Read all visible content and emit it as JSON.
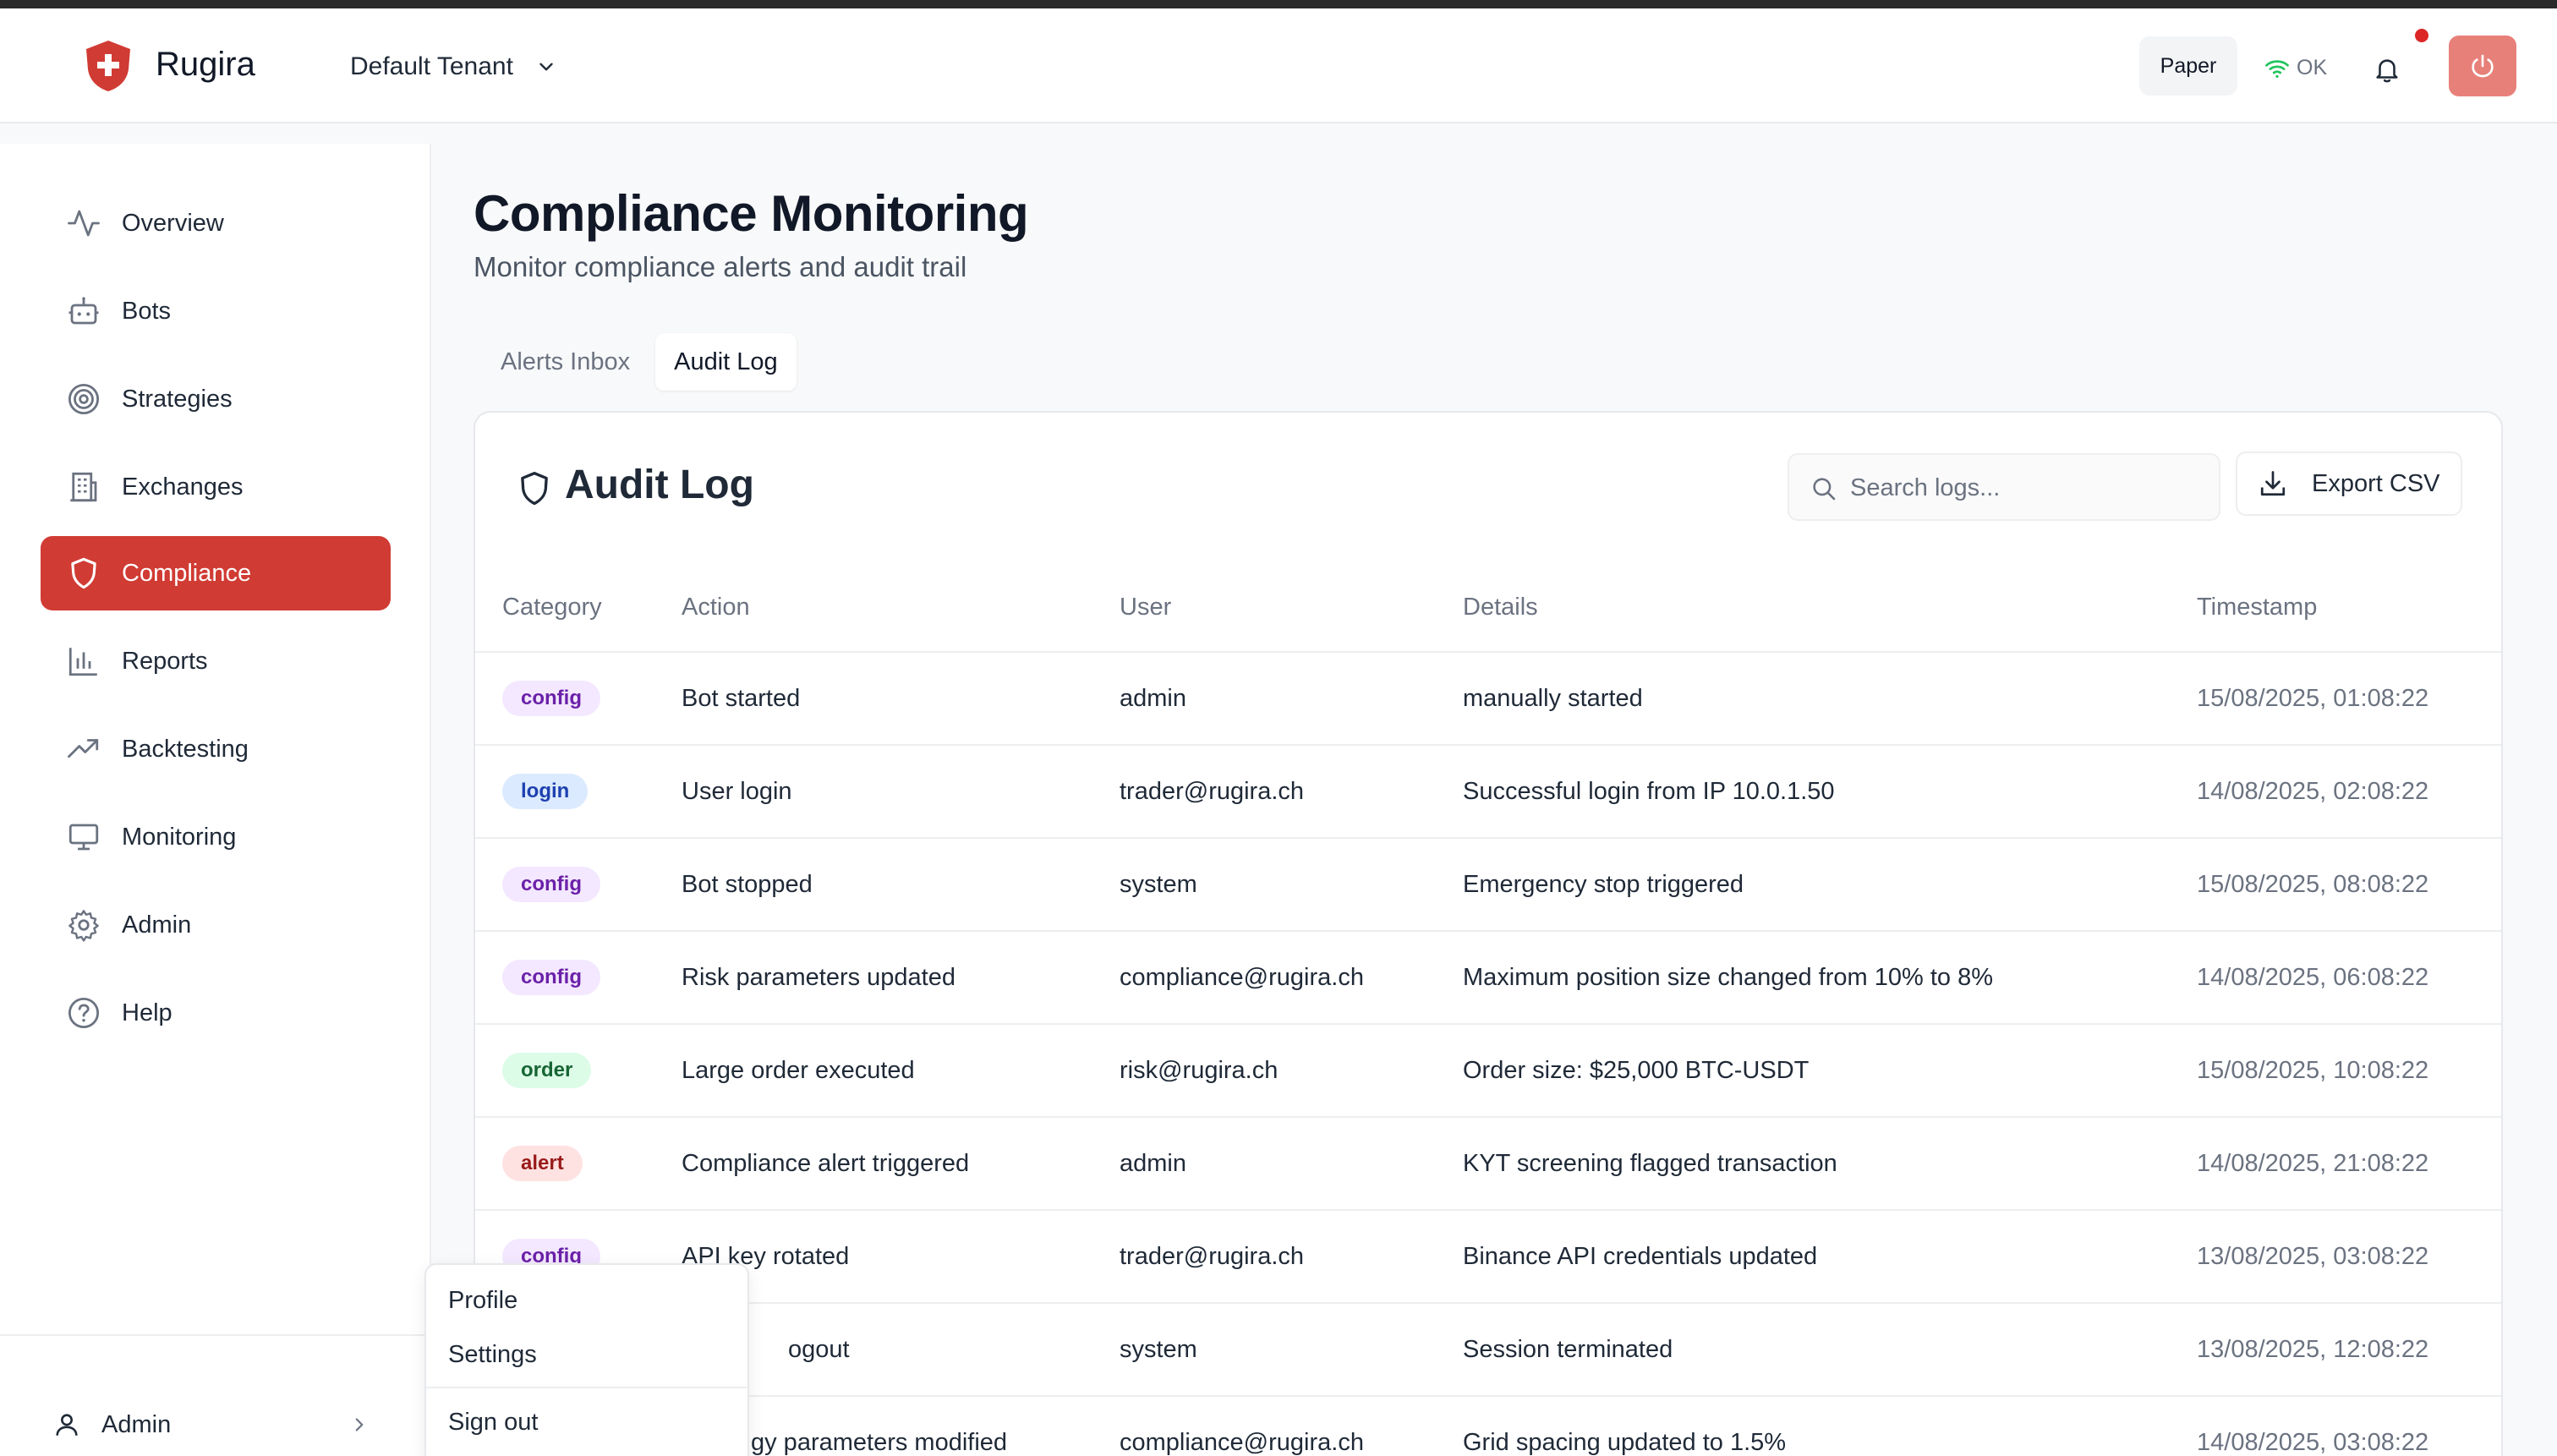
{
  "app": {
    "brand": "Rugira",
    "tenant": "Default Tenant",
    "mode": "Paper",
    "status": "OK"
  },
  "colors": {
    "accent": "#d03b33",
    "power_button": "#e8807a",
    "status_ok": "#22c55e",
    "notification_dot": "#dc2626"
  },
  "sidebar": {
    "items": [
      {
        "label": "Overview",
        "icon": "activity-icon"
      },
      {
        "label": "Bots",
        "icon": "bot-icon"
      },
      {
        "label": "Strategies",
        "icon": "target-icon"
      },
      {
        "label": "Exchanges",
        "icon": "building-icon"
      },
      {
        "label": "Compliance",
        "icon": "shield-icon",
        "active": true
      },
      {
        "label": "Reports",
        "icon": "bar-chart-icon"
      },
      {
        "label": "Backtesting",
        "icon": "trending-up-icon"
      },
      {
        "label": "Monitoring",
        "icon": "monitor-icon"
      },
      {
        "label": "Admin",
        "icon": "gear-icon"
      },
      {
        "label": "Help",
        "icon": "help-circle-icon"
      }
    ],
    "user": "Admin"
  },
  "page": {
    "title": "Compliance Monitoring",
    "subtitle": "Monitor compliance alerts and audit trail"
  },
  "tabs": [
    {
      "label": "Alerts Inbox",
      "active": false
    },
    {
      "label": "Audit Log",
      "active": true
    }
  ],
  "audit": {
    "title": "Audit Log",
    "search_placeholder": "Search logs...",
    "export_label": "Export CSV",
    "columns": [
      "Category",
      "Action",
      "User",
      "Details",
      "Timestamp"
    ],
    "rows": [
      {
        "category": "config",
        "action": "Bot started",
        "user": "admin",
        "details": "manually started",
        "timestamp": "15/08/2025, 01:08:22"
      },
      {
        "category": "login",
        "action": "User login",
        "user": "trader@rugira.ch",
        "details": "Successful login from IP 10.0.1.50",
        "timestamp": "14/08/2025, 02:08:22"
      },
      {
        "category": "config",
        "action": "Bot stopped",
        "user": "system",
        "details": "Emergency stop triggered",
        "timestamp": "15/08/2025, 08:08:22"
      },
      {
        "category": "config",
        "action": "Risk parameters updated",
        "user": "compliance@rugira.ch",
        "details": "Maximum position size changed from 10% to 8%",
        "timestamp": "14/08/2025, 06:08:22"
      },
      {
        "category": "order",
        "action": "Large order executed",
        "user": "risk@rugira.ch",
        "details": "Order size: $25,000 BTC-USDT",
        "timestamp": "15/08/2025, 10:08:22"
      },
      {
        "category": "alert",
        "action": "Compliance alert triggered",
        "user": "admin",
        "details": "KYT screening flagged transaction",
        "timestamp": "14/08/2025, 21:08:22"
      },
      {
        "category": "config",
        "action": "API key rotated",
        "user": "trader@rugira.ch",
        "details": "Binance API credentials updated",
        "timestamp": "13/08/2025, 03:08:22"
      },
      {
        "category": "",
        "action": "ogout",
        "user": "system",
        "details": "Session terminated",
        "timestamp": "13/08/2025, 12:08:22"
      },
      {
        "category": "",
        "action": "gy parameters modified",
        "user": "compliance@rugira.ch",
        "details": "Grid spacing updated to 1.5%",
        "timestamp": "14/08/2025, 03:08:22"
      }
    ]
  },
  "user_menu": {
    "items": [
      "Profile",
      "Settings"
    ],
    "sign_out": "Sign out"
  }
}
